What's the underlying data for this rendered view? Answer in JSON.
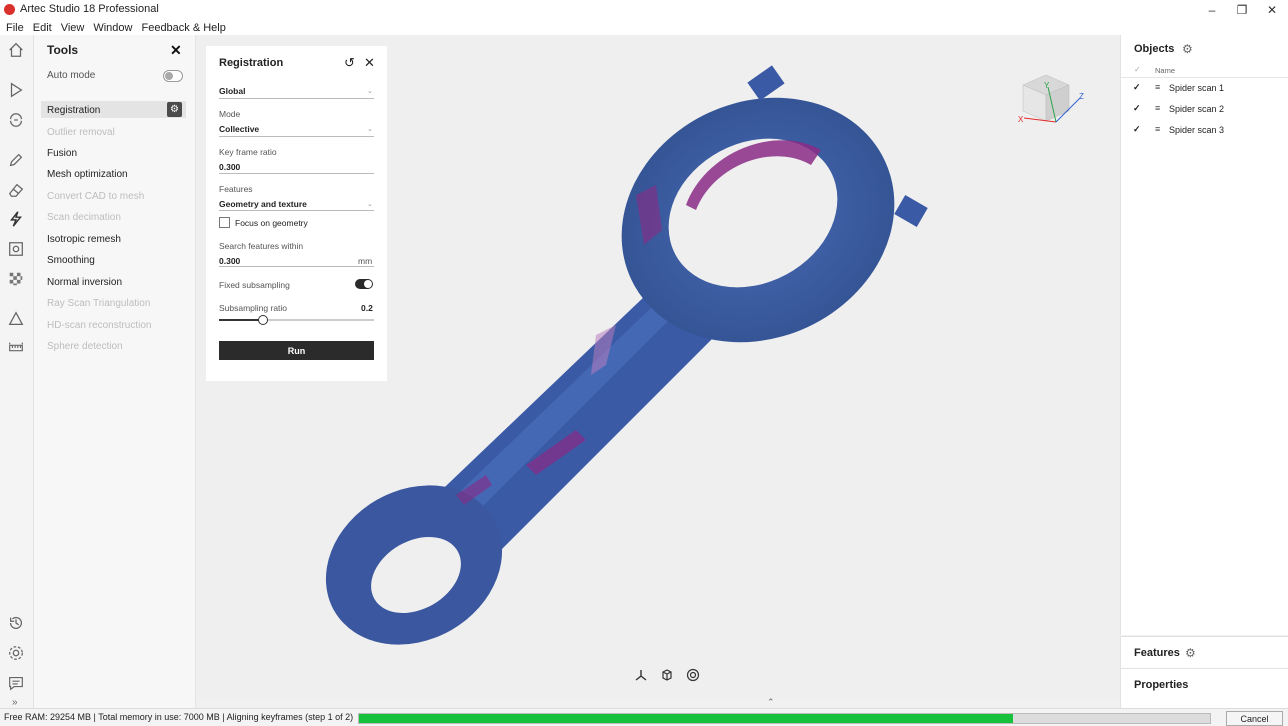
{
  "window": {
    "title": "Artec Studio 18 Professional"
  },
  "menu": {
    "items": [
      "File",
      "Edit",
      "View",
      "Window",
      "Feedback & Help"
    ]
  },
  "tools": {
    "title": "Tools",
    "auto_mode_label": "Auto mode",
    "items": [
      {
        "label": "Registration",
        "state": "selected"
      },
      {
        "label": "Outlier removal",
        "state": "disabled"
      },
      {
        "label": "Fusion",
        "state": "enabled"
      },
      {
        "label": "Mesh optimization",
        "state": "enabled"
      },
      {
        "label": "Convert CAD to mesh",
        "state": "disabled"
      },
      {
        "label": "Scan decimation",
        "state": "disabled"
      },
      {
        "label": "Isotropic remesh",
        "state": "enabled"
      },
      {
        "label": "Smoothing",
        "state": "enabled"
      },
      {
        "label": "Normal inversion",
        "state": "enabled"
      },
      {
        "label": "Ray Scan Triangulation",
        "state": "disabled"
      },
      {
        "label": "HD-scan reconstruction",
        "state": "disabled"
      },
      {
        "label": "Sphere detection",
        "state": "disabled"
      }
    ]
  },
  "registration": {
    "title": "Registration",
    "type_value": "Global",
    "mode_label": "Mode",
    "mode_value": "Collective",
    "key_frame_ratio_label": "Key frame ratio",
    "key_frame_ratio_value": "0.300",
    "features_label": "Features",
    "features_value": "Geometry and texture",
    "focus_geometry_label": "Focus on geometry",
    "search_label": "Search features within",
    "search_value": "0.300",
    "search_unit": "mm",
    "fixed_subsampling_label": "Fixed subsampling",
    "subsampling_ratio_label": "Subsampling ratio",
    "subsampling_ratio_value": "0.2",
    "subsampling_ratio_fraction": 0.28,
    "run_label": "Run"
  },
  "objects": {
    "title": "Objects",
    "column_name": "Name",
    "items": [
      {
        "name": "Spider scan 1",
        "checked": true
      },
      {
        "name": "Spider scan 2",
        "checked": true
      },
      {
        "name": "Spider scan 3",
        "checked": true
      }
    ]
  },
  "features_panel": {
    "title": "Features"
  },
  "properties_panel": {
    "title": "Properties"
  },
  "status": {
    "text": "Free RAM: 29254 MB | Total memory in use: 7000 MB | Aligning keyframes (step 1 of 2)",
    "progress_fraction": 0.768,
    "cancel_label": "Cancel"
  },
  "viewcube": {
    "x": "X",
    "y": "Y",
    "z": "Z"
  },
  "colors": {
    "accent_green": "#17c13c",
    "mesh_blue": "#3e5fa8",
    "mesh_magenta": "#8a2a86",
    "toggle_on": "#2b2b2b"
  },
  "icons": {
    "sidebar": [
      "home-icon",
      "play-icon",
      "scan-icon",
      "edit-icon",
      "eraser-icon",
      "tools-icon",
      "texture-icon",
      "checker-icon",
      "measure-icon",
      "ruler-icon",
      "history-icon",
      "settings-icon",
      "chat-icon"
    ],
    "bottom": [
      "axes-icon",
      "cube-icon",
      "target-icon"
    ]
  }
}
